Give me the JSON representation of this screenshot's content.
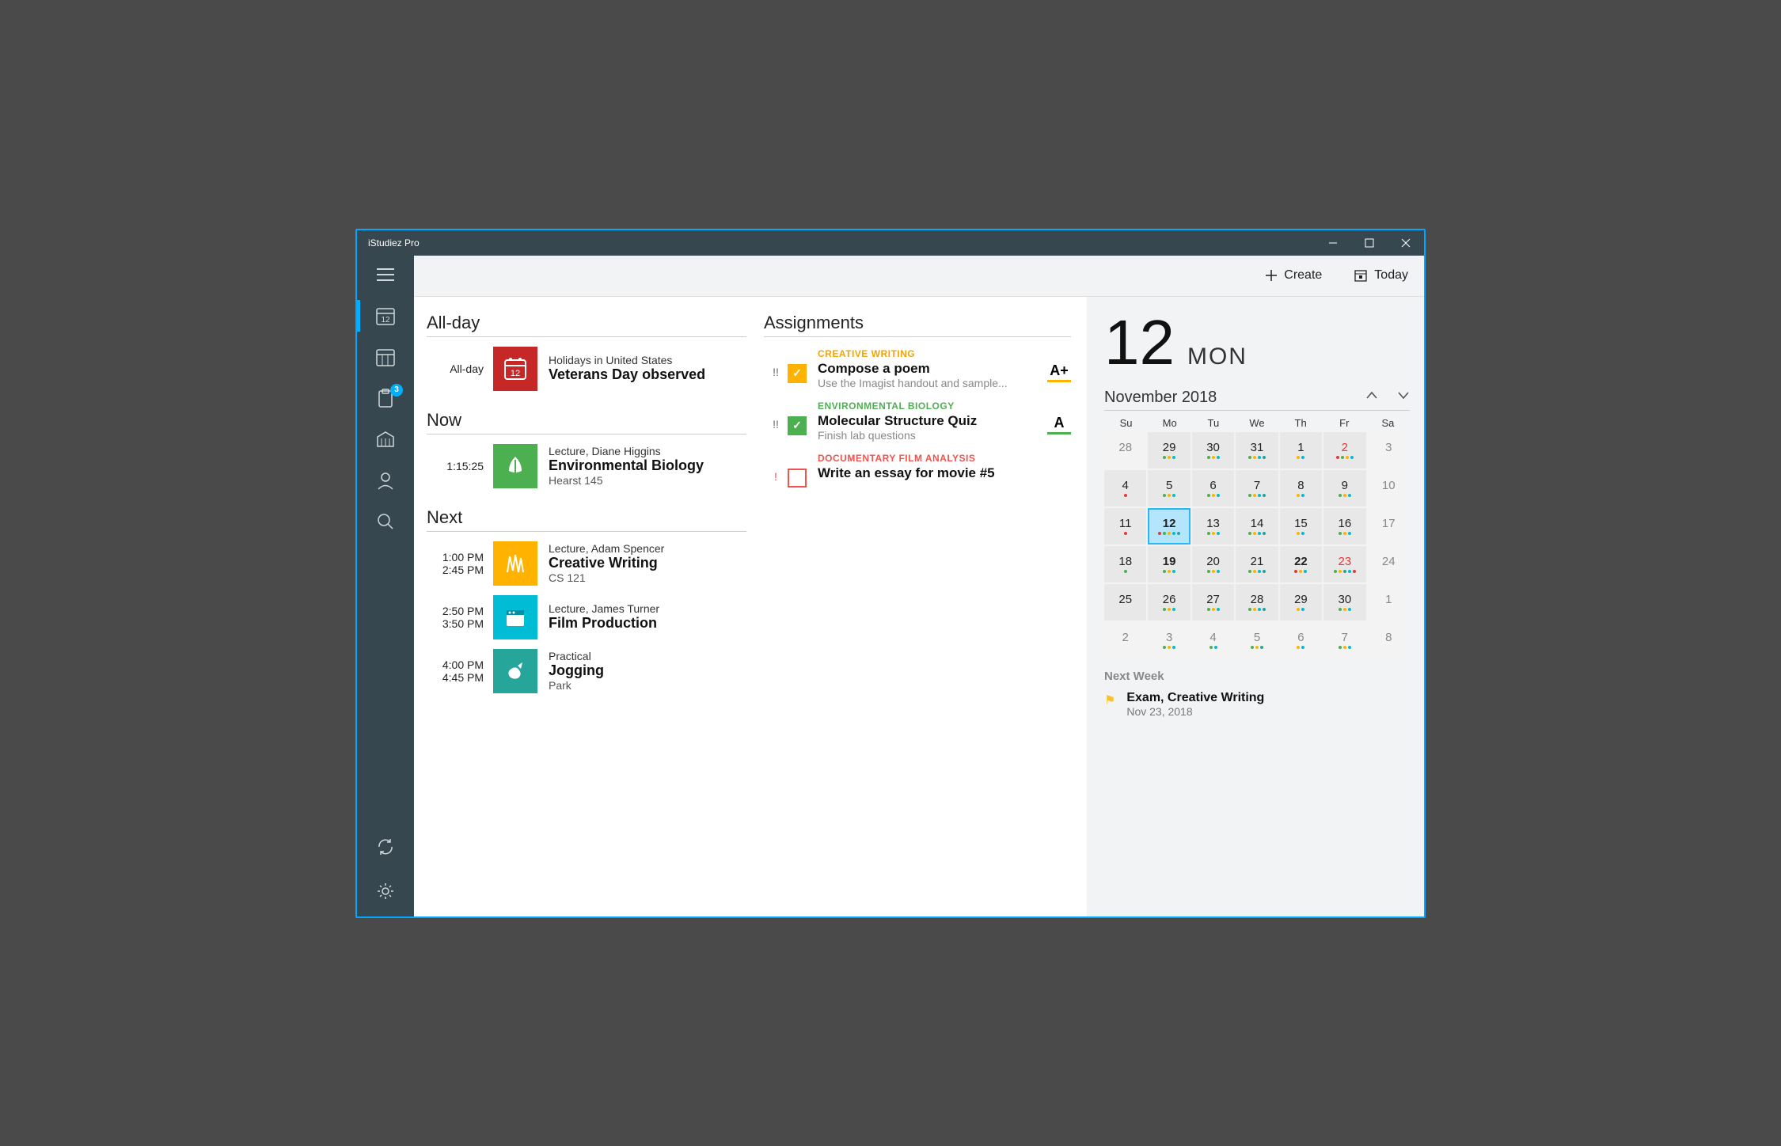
{
  "app_title": "iStudiez Pro",
  "toolbar": {
    "create": "Create",
    "today": "Today"
  },
  "sidebar": {
    "badge": "3"
  },
  "schedule": {
    "allday_header": "All-day",
    "now_header": "Now",
    "next_header": "Next",
    "allday": {
      "time_label": "All-day",
      "line1": "Holidays in United States",
      "title": "Veterans Day observed",
      "tile_color": "#c62828",
      "tile_text": "12"
    },
    "now": {
      "time_label": "1:15:25",
      "line1": "Lecture, Diane Higgins",
      "title": "Environmental Biology",
      "loc": "Hearst 145",
      "tile_color": "#4caf50"
    },
    "next": [
      {
        "t1": "1:00 PM",
        "t2": "2:45 PM",
        "line1": "Lecture, Adam Spencer",
        "title": "Creative Writing",
        "loc": "CS 121",
        "tile_color": "#ffb300"
      },
      {
        "t1": "2:50 PM",
        "t2": "3:50 PM",
        "line1": "Lecture, James Turner",
        "title": "Film Production",
        "loc": "",
        "tile_color": "#00bcd4"
      },
      {
        "t1": "4:00 PM",
        "t2": "4:45 PM",
        "line1": "Practical",
        "title": "Jogging",
        "loc": "Park",
        "tile_color": "#26a69a"
      }
    ]
  },
  "assignments": {
    "header": "Assignments",
    "items": [
      {
        "priority": "!!",
        "chk_bg": "#ffb300",
        "chk_border": "#ffb300",
        "checked": true,
        "course": "CREATIVE WRITING",
        "course_color": "#f5a300",
        "title": "Compose a poem",
        "sub": "Use the Imagist handout and sample...",
        "grade": "A+",
        "grade_color": "#ffb300"
      },
      {
        "priority": "!!",
        "chk_bg": "#4caf50",
        "chk_border": "#4caf50",
        "checked": true,
        "course": "ENVIRONMENTAL BIOLOGY",
        "course_color": "#4caf50",
        "title": "Molecular Structure Quiz",
        "sub": "Finish lab questions",
        "grade": "A",
        "grade_color": "#4caf50"
      },
      {
        "priority": "!",
        "chk_bg": "#ffffff",
        "chk_border": "#ef5350",
        "checked": false,
        "course": "DOCUMENTARY FILM ANALYSIS",
        "course_color": "#ef5350",
        "title": "Write an essay for movie #5",
        "sub": "",
        "grade": "",
        "grade_color": ""
      }
    ]
  },
  "date": {
    "day": "12",
    "dow": "MON",
    "month_label": "November 2018"
  },
  "weekdays": [
    "Su",
    "Mo",
    "Tu",
    "We",
    "Th",
    "Fr",
    "Sa"
  ],
  "calendar": [
    {
      "n": "28",
      "cls": "out",
      "d": []
    },
    {
      "n": "29",
      "cls": "",
      "d": [
        "#4caf50",
        "#ffb300",
        "#00bcd4"
      ]
    },
    {
      "n": "30",
      "cls": "",
      "d": [
        "#4caf50",
        "#ffb300",
        "#00bcd4"
      ]
    },
    {
      "n": "31",
      "cls": "",
      "d": [
        "#4caf50",
        "#ffb300",
        "#00bcd4",
        "#26a69a"
      ]
    },
    {
      "n": "1",
      "cls": "",
      "d": [
        "#ffb300",
        "#00bcd4"
      ]
    },
    {
      "n": "2",
      "cls": "red",
      "d": [
        "#e53935",
        "#4caf50",
        "#ffb300",
        "#00bcd4"
      ]
    },
    {
      "n": "3",
      "cls": "out",
      "d": []
    },
    {
      "n": "4",
      "cls": "",
      "d": [
        "#e53935"
      ]
    },
    {
      "n": "5",
      "cls": "",
      "d": [
        "#4caf50",
        "#ffb300",
        "#00bcd4"
      ]
    },
    {
      "n": "6",
      "cls": "",
      "d": [
        "#4caf50",
        "#ffb300",
        "#00bcd4"
      ]
    },
    {
      "n": "7",
      "cls": "",
      "d": [
        "#4caf50",
        "#ffb300",
        "#00bcd4",
        "#26a69a"
      ]
    },
    {
      "n": "8",
      "cls": "",
      "d": [
        "#ffb300",
        "#00bcd4"
      ]
    },
    {
      "n": "9",
      "cls": "",
      "d": [
        "#4caf50",
        "#ffb300",
        "#00bcd4"
      ]
    },
    {
      "n": "10",
      "cls": "out",
      "d": []
    },
    {
      "n": "11",
      "cls": "",
      "d": [
        "#e53935"
      ]
    },
    {
      "n": "12",
      "cls": "today",
      "d": [
        "#e53935",
        "#4caf50",
        "#ffb300",
        "#00bcd4",
        "#26a69a"
      ]
    },
    {
      "n": "13",
      "cls": "",
      "d": [
        "#4caf50",
        "#ffb300",
        "#00bcd4"
      ]
    },
    {
      "n": "14",
      "cls": "",
      "d": [
        "#4caf50",
        "#ffb300",
        "#00bcd4",
        "#26a69a"
      ]
    },
    {
      "n": "15",
      "cls": "",
      "d": [
        "#ffb300",
        "#00bcd4"
      ]
    },
    {
      "n": "16",
      "cls": "",
      "d": [
        "#4caf50",
        "#ffb300",
        "#00bcd4"
      ]
    },
    {
      "n": "17",
      "cls": "out",
      "d": []
    },
    {
      "n": "18",
      "cls": "",
      "d": [
        "#4caf50"
      ]
    },
    {
      "n": "19",
      "cls": "bold",
      "d": [
        "#4caf50",
        "#ffb300",
        "#00bcd4"
      ]
    },
    {
      "n": "20",
      "cls": "",
      "d": [
        "#4caf50",
        "#ffb300",
        "#00bcd4"
      ]
    },
    {
      "n": "21",
      "cls": "",
      "d": [
        "#4caf50",
        "#ffb300",
        "#00bcd4",
        "#26a69a"
      ]
    },
    {
      "n": "22",
      "cls": "bold",
      "d": [
        "#e53935",
        "#ffb300",
        "#00bcd4"
      ]
    },
    {
      "n": "23",
      "cls": "red",
      "d": [
        "#4caf50",
        "#ffb300",
        "#26a69a",
        "#00bcd4",
        "#e53935"
      ]
    },
    {
      "n": "24",
      "cls": "out",
      "d": []
    },
    {
      "n": "25",
      "cls": "",
      "d": []
    },
    {
      "n": "26",
      "cls": "",
      "d": [
        "#4caf50",
        "#ffb300",
        "#00bcd4"
      ]
    },
    {
      "n": "27",
      "cls": "",
      "d": [
        "#4caf50",
        "#ffb300",
        "#00bcd4"
      ]
    },
    {
      "n": "28",
      "cls": "",
      "d": [
        "#4caf50",
        "#ffb300",
        "#00bcd4",
        "#26a69a"
      ]
    },
    {
      "n": "29",
      "cls": "",
      "d": [
        "#ffb300",
        "#00bcd4"
      ]
    },
    {
      "n": "30",
      "cls": "",
      "d": [
        "#4caf50",
        "#ffb300",
        "#00bcd4"
      ]
    },
    {
      "n": "1",
      "cls": "out",
      "d": []
    },
    {
      "n": "2",
      "cls": "out",
      "d": []
    },
    {
      "n": "3",
      "cls": "out",
      "d": [
        "#4caf50",
        "#ffb300",
        "#00bcd4"
      ]
    },
    {
      "n": "4",
      "cls": "out",
      "d": [
        "#4caf50",
        "#00bcd4"
      ]
    },
    {
      "n": "5",
      "cls": "out",
      "d": [
        "#4caf50",
        "#ffb300",
        "#26a69a"
      ]
    },
    {
      "n": "6",
      "cls": "out",
      "d": [
        "#ffb300",
        "#00bcd4"
      ]
    },
    {
      "n": "7",
      "cls": "out",
      "d": [
        "#4caf50",
        "#ffb300",
        "#00bcd4"
      ]
    },
    {
      "n": "8",
      "cls": "out",
      "d": []
    }
  ],
  "next_week": {
    "header": "Next Week",
    "title": "Exam, Creative Writing",
    "date": "Nov 23, 2018"
  }
}
